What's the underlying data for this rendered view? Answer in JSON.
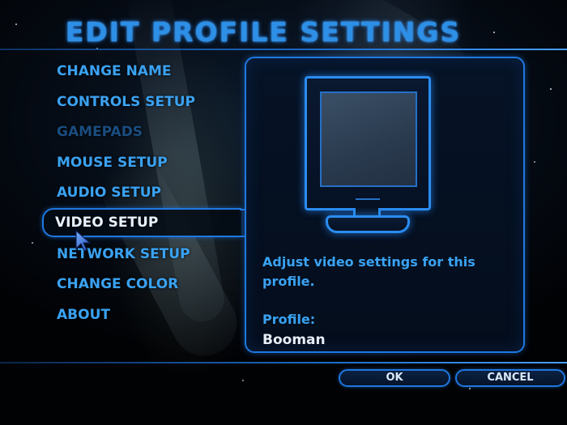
{
  "title": "EDIT PROFILE SETTINGS",
  "menu": {
    "items": [
      {
        "label": "CHANGE NAME",
        "state": "normal"
      },
      {
        "label": "CONTROLS SETUP",
        "state": "normal"
      },
      {
        "label": "GAMEPADS",
        "state": "disabled"
      },
      {
        "label": "MOUSE SETUP",
        "state": "normal"
      },
      {
        "label": "AUDIO SETUP",
        "state": "normal"
      },
      {
        "label": "VIDEO SETUP",
        "state": "selected"
      },
      {
        "label": "NETWORK SETUP",
        "state": "normal"
      },
      {
        "label": "CHANGE COLOR",
        "state": "normal"
      },
      {
        "label": "ABOUT",
        "state": "normal"
      }
    ]
  },
  "panel": {
    "icon": "monitor-icon",
    "description": "Adjust video settings for this profile.",
    "profile_label": "Profile:",
    "profile_value": "Booman"
  },
  "buttons": {
    "ok": "OK",
    "cancel": "CANCEL"
  },
  "colors": {
    "accent": "#1e78e0",
    "menu_text": "#3aa2f2",
    "menu_disabled": "#1a4d7f",
    "selected_text": "#e8f2ff"
  }
}
